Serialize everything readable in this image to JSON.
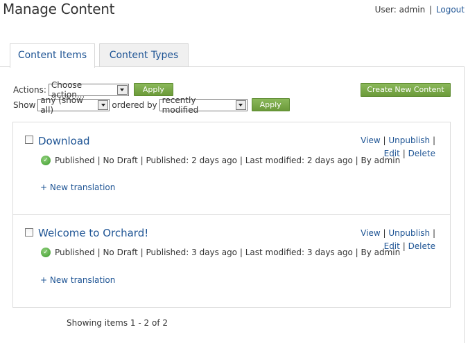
{
  "page_title": "Manage Content",
  "user": {
    "prefix": "User:",
    "name": "admin",
    "separator": "|",
    "logout": "Logout"
  },
  "tabs": [
    {
      "label": "Content Items",
      "active": true
    },
    {
      "label": "Content Types",
      "active": false
    }
  ],
  "actions": {
    "label": "Actions:",
    "select_value": "Choose action...",
    "apply": "Apply"
  },
  "filter": {
    "show_label": "Show",
    "show_value": "any (show all)",
    "ordered_by_label": "ordered by",
    "order_value": "recently modified",
    "apply": "Apply"
  },
  "create_button": "Create New Content",
  "items": [
    {
      "title": "Download",
      "status": "Published | No Draft | Published: 2 days ago | Last modified: 2 days ago | By admin",
      "new_translation": "+ New translation",
      "view": "View",
      "unpublish": "Unpublish",
      "edit": "Edit",
      "delete": "Delete"
    },
    {
      "title": "Welcome to Orchard!",
      "status": "Published | No Draft | Published: 3 days ago | Last modified: 3 days ago | By admin",
      "new_translation": "+ New translation",
      "view": "View",
      "unpublish": "Unpublish",
      "edit": "Edit",
      "delete": "Delete"
    }
  ],
  "pager": "Showing items 1 - 2 of 2",
  "colors": {
    "link": "#1e5494",
    "button_green": "#6b9a3a",
    "border": "#d8d8d8"
  },
  "icons": {
    "status": "published-check-icon",
    "dropdown": "chevron-down-icon"
  }
}
